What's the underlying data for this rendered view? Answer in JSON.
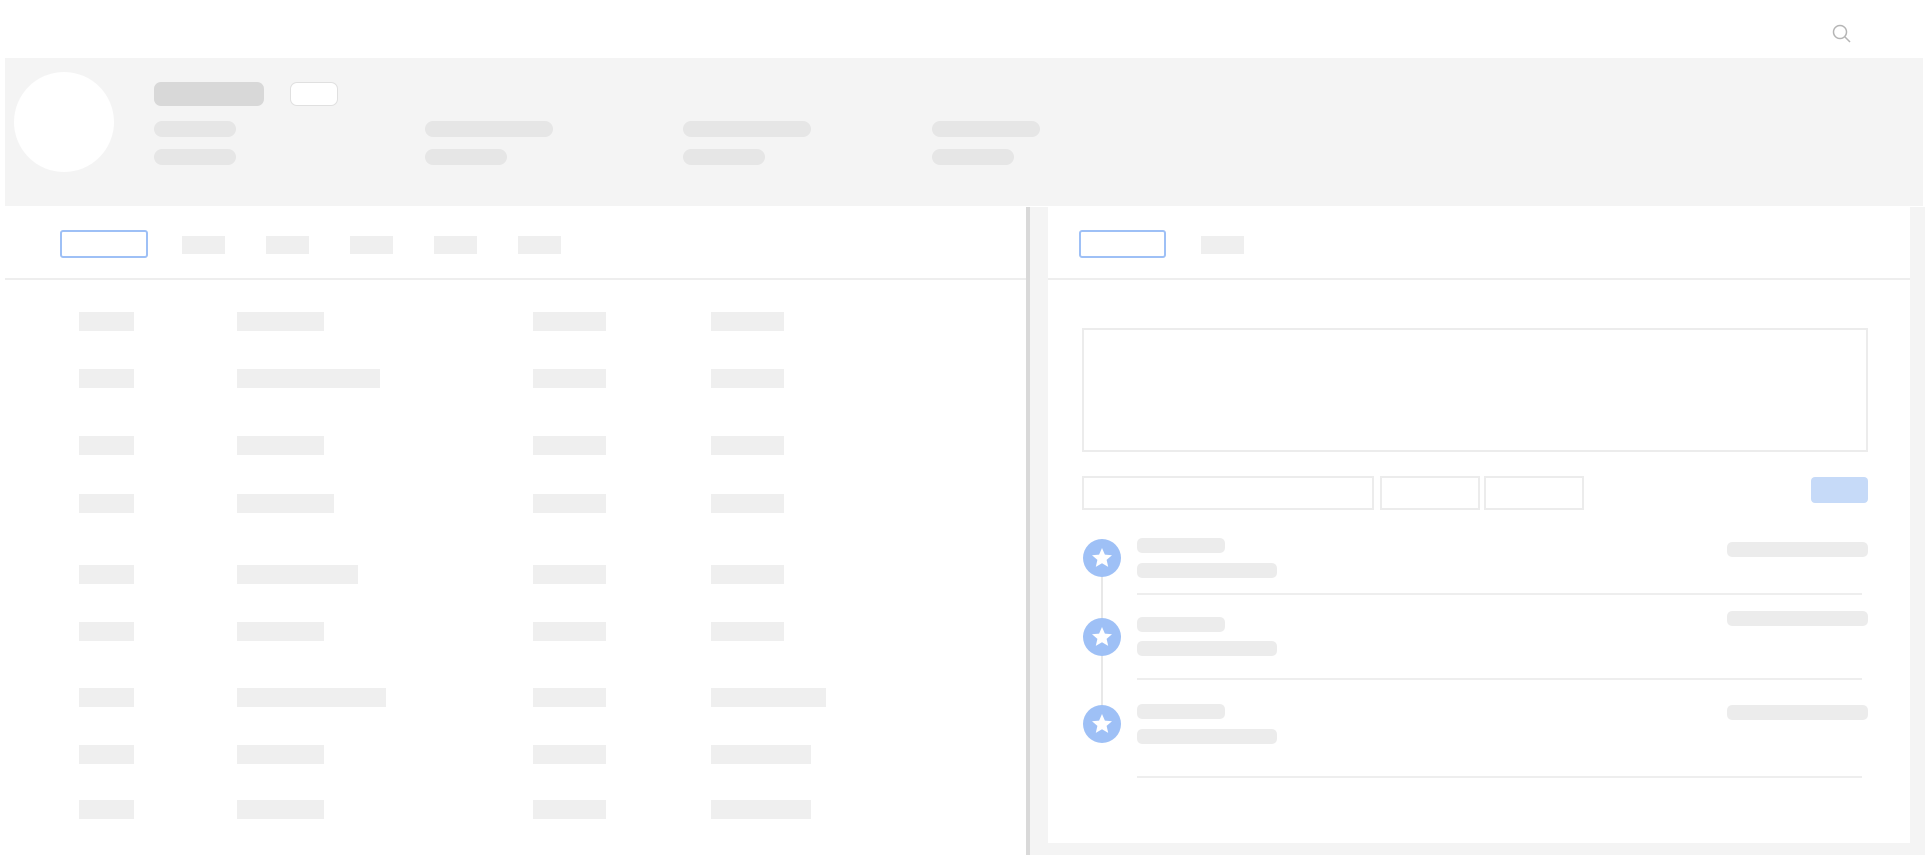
{
  "colors": {
    "accent": "#9ec0f6",
    "submit_button": "#c6daf8",
    "header_background": "#f4f4f4",
    "placeholder_block": "#efefef"
  },
  "icons": {
    "search": "search-icon",
    "timeline": "star-icon"
  },
  "left_tabs": [
    {
      "state": "selected"
    },
    {
      "state": "default"
    },
    {
      "state": "default"
    },
    {
      "state": "default"
    },
    {
      "state": "default"
    },
    {
      "state": "default"
    }
  ],
  "right_tabs": [
    {
      "state": "selected"
    },
    {
      "state": "default"
    }
  ],
  "table": {
    "row_count": 9,
    "column_count": 4
  },
  "timeline": {
    "entry_count": 3,
    "entry_icon": "star-icon"
  }
}
